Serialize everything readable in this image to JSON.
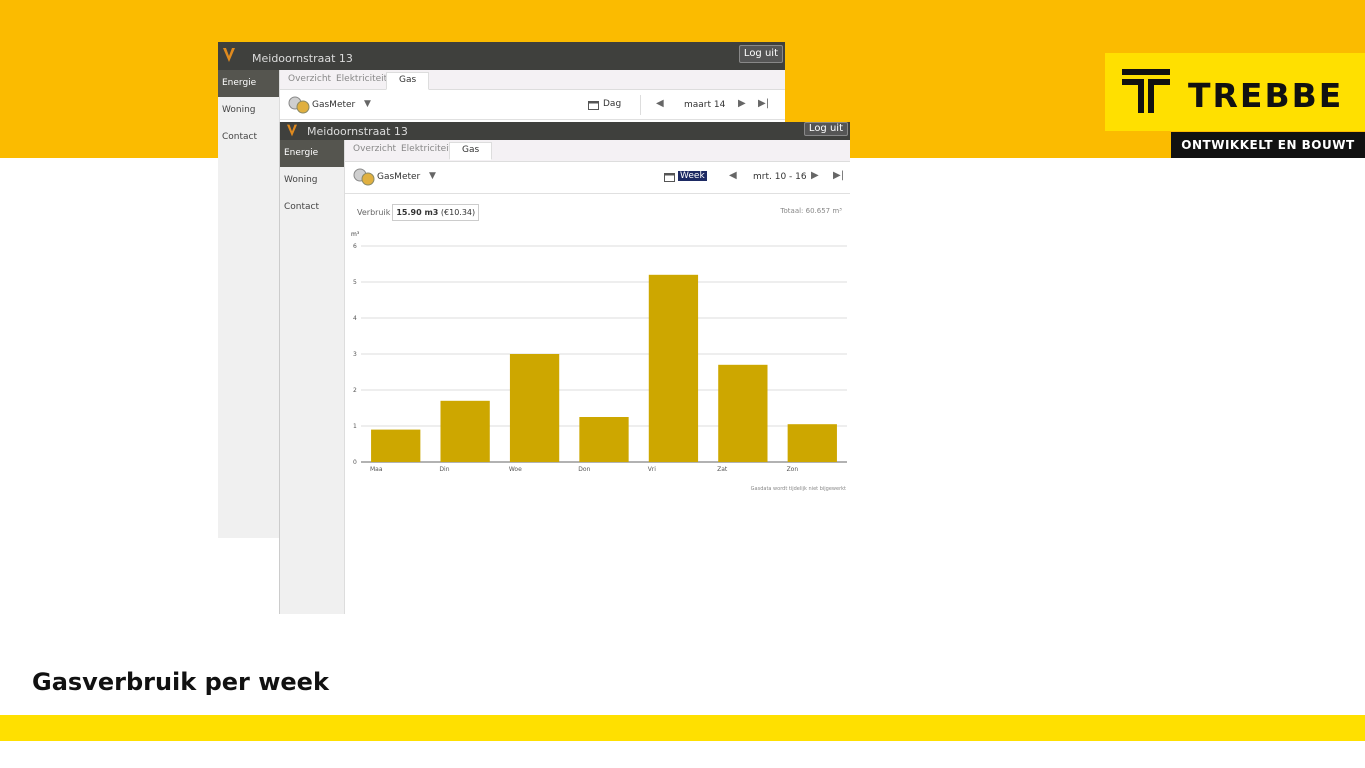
{
  "brand": {
    "name": "TREBBE",
    "tagline": "ONTWIKKELT EN BOUWT",
    "color_yellow": "#ffe000",
    "color_orange": "#fbbb00",
    "color_black": "#111111"
  },
  "caption": "Gasverbruik per week",
  "back_window": {
    "title": "Meidoornstraat 13",
    "logout_label": "Log uit",
    "sidebar": [
      "Energie",
      "Woning",
      "Contact"
    ],
    "tabs": [
      "Overzicht",
      "Elektriciteit",
      "Gas"
    ],
    "meter": "GasMeter",
    "period": "Dag",
    "range": "maart 14"
  },
  "front_window": {
    "title": "Meidoornstraat 13",
    "logout_label": "Log uit",
    "sidebar": [
      "Energie",
      "Woning",
      "Contact"
    ],
    "tabs": [
      "Overzicht",
      "Elektriciteit",
      "Gas"
    ],
    "meter": "GasMeter",
    "period": "Week",
    "range": "mrt. 10 - 16",
    "usage_label": "Verbruik",
    "usage_amount": "15.90 m3",
    "usage_cost": "(€10.34)",
    "total": "Totaal: 60.657 m³",
    "footnote": "Gasdata wordt tijdelijk niet bijgewerkt",
    "bar_color": "#cda700"
  },
  "chart_data": {
    "type": "bar",
    "categories": [
      "Maa",
      "Din",
      "Woe",
      "Don",
      "Vri",
      "Zat",
      "Zon"
    ],
    "values": [
      0.9,
      1.7,
      3.0,
      1.25,
      5.2,
      2.7,
      1.05
    ],
    "ylabel": "m³",
    "ylim": [
      0,
      6
    ],
    "yticks": [
      0,
      1,
      2,
      3,
      4,
      5,
      6
    ],
    "grid": true,
    "legend": "none"
  }
}
